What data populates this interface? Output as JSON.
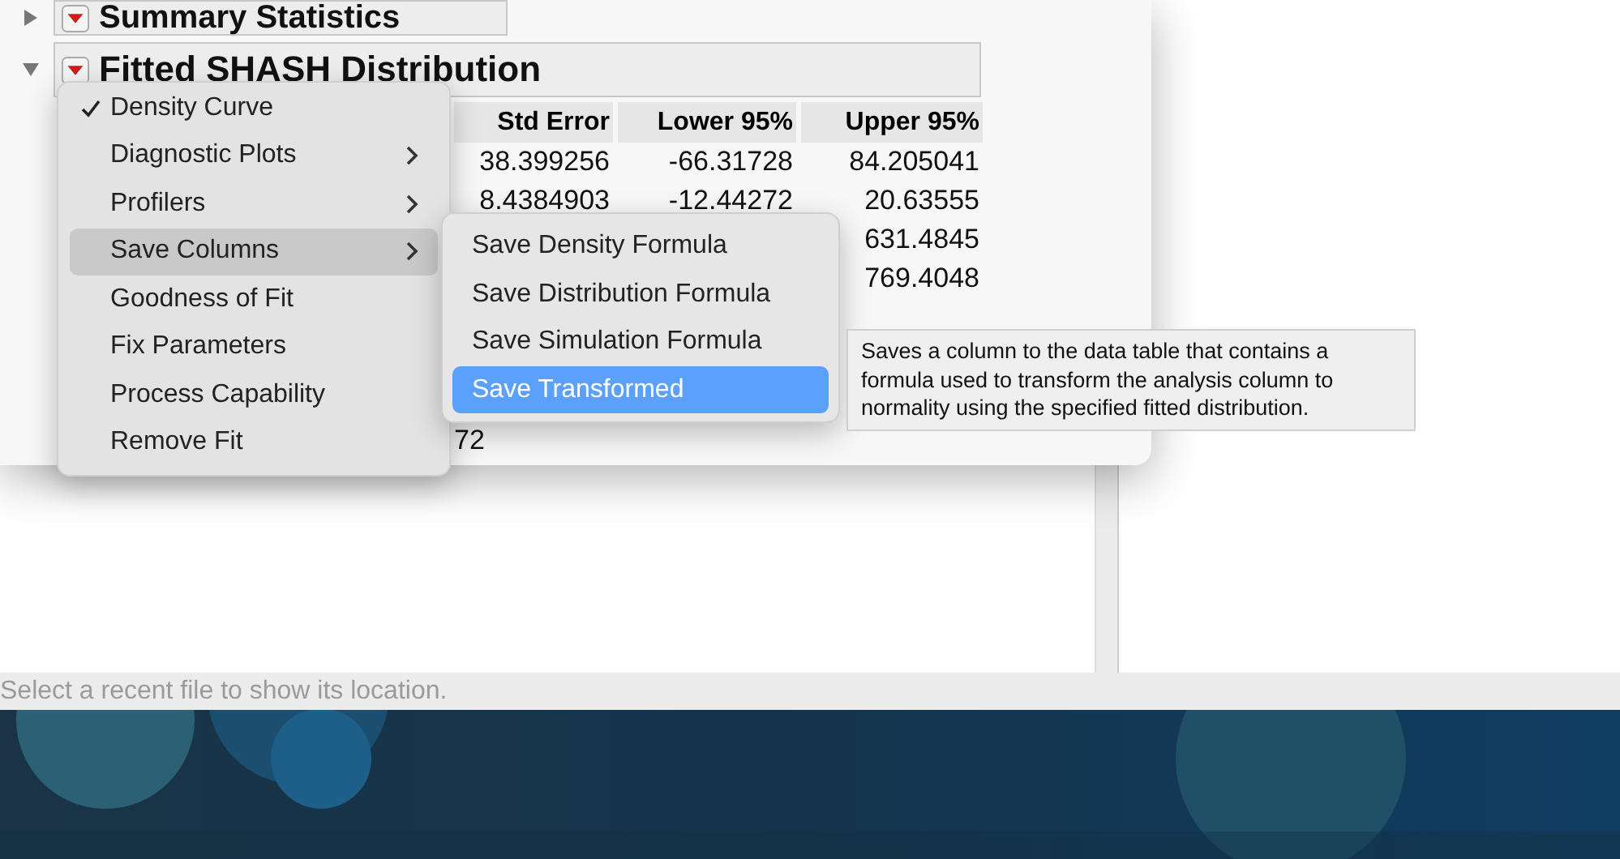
{
  "report": {
    "sections": [
      {
        "title": "Summary Statistics",
        "expanded": false
      },
      {
        "title": "Fitted SHASH Distribution",
        "expanded": true
      }
    ],
    "table": {
      "columns": [
        "Std Error",
        "Lower 95%",
        "Upper 95%"
      ],
      "rows": [
        {
          "std_error": "38.399256",
          "lower_95": "-66.31728",
          "upper_95": "84.205041"
        },
        {
          "std_error": "8.4384903",
          "lower_95": "-12.44272",
          "upper_95": "20.63555"
        },
        {
          "upper_95": "631.4845"
        },
        {
          "upper_95": "769.4048"
        }
      ]
    },
    "trailing_value": "72"
  },
  "context_menu": {
    "items": [
      {
        "label": "Density Curve",
        "checked": true,
        "submenu": false,
        "selected": false
      },
      {
        "label": "Diagnostic Plots",
        "checked": false,
        "submenu": true,
        "selected": false
      },
      {
        "label": "Profilers",
        "checked": false,
        "submenu": true,
        "selected": false
      },
      {
        "label": "Save Columns",
        "checked": false,
        "submenu": true,
        "selected": true
      },
      {
        "label": "Goodness of Fit",
        "checked": false,
        "submenu": false,
        "selected": false
      },
      {
        "label": "Fix Parameters",
        "checked": false,
        "submenu": false,
        "selected": false
      },
      {
        "label": "Process Capability",
        "checked": false,
        "submenu": false,
        "selected": false
      },
      {
        "label": "Remove Fit",
        "checked": false,
        "submenu": false,
        "selected": false
      }
    ]
  },
  "submenu": {
    "items": [
      {
        "label": "Save Density Formula",
        "selected": false
      },
      {
        "label": "Save Distribution Formula",
        "selected": false
      },
      {
        "label": "Save Simulation Formula",
        "selected": false
      },
      {
        "label": "Save Transformed",
        "selected": true
      }
    ]
  },
  "tooltip": {
    "text": "Saves a column to the data table that contains a formula used to transform the analysis column to normality using the specified fitted distribution."
  },
  "status_bar": {
    "text": "Select a recent file to show its location."
  }
}
